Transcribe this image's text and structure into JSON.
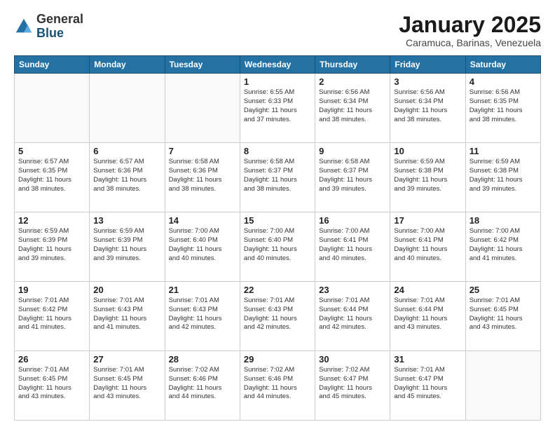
{
  "logo": {
    "general": "General",
    "blue": "Blue"
  },
  "header": {
    "title": "January 2025",
    "subtitle": "Caramuca, Barinas, Venezuela"
  },
  "weekdays": [
    "Sunday",
    "Monday",
    "Tuesday",
    "Wednesday",
    "Thursday",
    "Friday",
    "Saturday"
  ],
  "weeks": [
    [
      {
        "day": "",
        "info": ""
      },
      {
        "day": "",
        "info": ""
      },
      {
        "day": "",
        "info": ""
      },
      {
        "day": "1",
        "info": "Sunrise: 6:55 AM\nSunset: 6:33 PM\nDaylight: 11 hours\nand 37 minutes."
      },
      {
        "day": "2",
        "info": "Sunrise: 6:56 AM\nSunset: 6:34 PM\nDaylight: 11 hours\nand 38 minutes."
      },
      {
        "day": "3",
        "info": "Sunrise: 6:56 AM\nSunset: 6:34 PM\nDaylight: 11 hours\nand 38 minutes."
      },
      {
        "day": "4",
        "info": "Sunrise: 6:56 AM\nSunset: 6:35 PM\nDaylight: 11 hours\nand 38 minutes."
      }
    ],
    [
      {
        "day": "5",
        "info": "Sunrise: 6:57 AM\nSunset: 6:35 PM\nDaylight: 11 hours\nand 38 minutes."
      },
      {
        "day": "6",
        "info": "Sunrise: 6:57 AM\nSunset: 6:36 PM\nDaylight: 11 hours\nand 38 minutes."
      },
      {
        "day": "7",
        "info": "Sunrise: 6:58 AM\nSunset: 6:36 PM\nDaylight: 11 hours\nand 38 minutes."
      },
      {
        "day": "8",
        "info": "Sunrise: 6:58 AM\nSunset: 6:37 PM\nDaylight: 11 hours\nand 38 minutes."
      },
      {
        "day": "9",
        "info": "Sunrise: 6:58 AM\nSunset: 6:37 PM\nDaylight: 11 hours\nand 39 minutes."
      },
      {
        "day": "10",
        "info": "Sunrise: 6:59 AM\nSunset: 6:38 PM\nDaylight: 11 hours\nand 39 minutes."
      },
      {
        "day": "11",
        "info": "Sunrise: 6:59 AM\nSunset: 6:38 PM\nDaylight: 11 hours\nand 39 minutes."
      }
    ],
    [
      {
        "day": "12",
        "info": "Sunrise: 6:59 AM\nSunset: 6:39 PM\nDaylight: 11 hours\nand 39 minutes."
      },
      {
        "day": "13",
        "info": "Sunrise: 6:59 AM\nSunset: 6:39 PM\nDaylight: 11 hours\nand 39 minutes."
      },
      {
        "day": "14",
        "info": "Sunrise: 7:00 AM\nSunset: 6:40 PM\nDaylight: 11 hours\nand 40 minutes."
      },
      {
        "day": "15",
        "info": "Sunrise: 7:00 AM\nSunset: 6:40 PM\nDaylight: 11 hours\nand 40 minutes."
      },
      {
        "day": "16",
        "info": "Sunrise: 7:00 AM\nSunset: 6:41 PM\nDaylight: 11 hours\nand 40 minutes."
      },
      {
        "day": "17",
        "info": "Sunrise: 7:00 AM\nSunset: 6:41 PM\nDaylight: 11 hours\nand 40 minutes."
      },
      {
        "day": "18",
        "info": "Sunrise: 7:00 AM\nSunset: 6:42 PM\nDaylight: 11 hours\nand 41 minutes."
      }
    ],
    [
      {
        "day": "19",
        "info": "Sunrise: 7:01 AM\nSunset: 6:42 PM\nDaylight: 11 hours\nand 41 minutes."
      },
      {
        "day": "20",
        "info": "Sunrise: 7:01 AM\nSunset: 6:43 PM\nDaylight: 11 hours\nand 41 minutes."
      },
      {
        "day": "21",
        "info": "Sunrise: 7:01 AM\nSunset: 6:43 PM\nDaylight: 11 hours\nand 42 minutes."
      },
      {
        "day": "22",
        "info": "Sunrise: 7:01 AM\nSunset: 6:43 PM\nDaylight: 11 hours\nand 42 minutes."
      },
      {
        "day": "23",
        "info": "Sunrise: 7:01 AM\nSunset: 6:44 PM\nDaylight: 11 hours\nand 42 minutes."
      },
      {
        "day": "24",
        "info": "Sunrise: 7:01 AM\nSunset: 6:44 PM\nDaylight: 11 hours\nand 43 minutes."
      },
      {
        "day": "25",
        "info": "Sunrise: 7:01 AM\nSunset: 6:45 PM\nDaylight: 11 hours\nand 43 minutes."
      }
    ],
    [
      {
        "day": "26",
        "info": "Sunrise: 7:01 AM\nSunset: 6:45 PM\nDaylight: 11 hours\nand 43 minutes."
      },
      {
        "day": "27",
        "info": "Sunrise: 7:01 AM\nSunset: 6:45 PM\nDaylight: 11 hours\nand 43 minutes."
      },
      {
        "day": "28",
        "info": "Sunrise: 7:02 AM\nSunset: 6:46 PM\nDaylight: 11 hours\nand 44 minutes."
      },
      {
        "day": "29",
        "info": "Sunrise: 7:02 AM\nSunset: 6:46 PM\nDaylight: 11 hours\nand 44 minutes."
      },
      {
        "day": "30",
        "info": "Sunrise: 7:02 AM\nSunset: 6:47 PM\nDaylight: 11 hours\nand 45 minutes."
      },
      {
        "day": "31",
        "info": "Sunrise: 7:01 AM\nSunset: 6:47 PM\nDaylight: 11 hours\nand 45 minutes."
      },
      {
        "day": "",
        "info": ""
      }
    ]
  ]
}
